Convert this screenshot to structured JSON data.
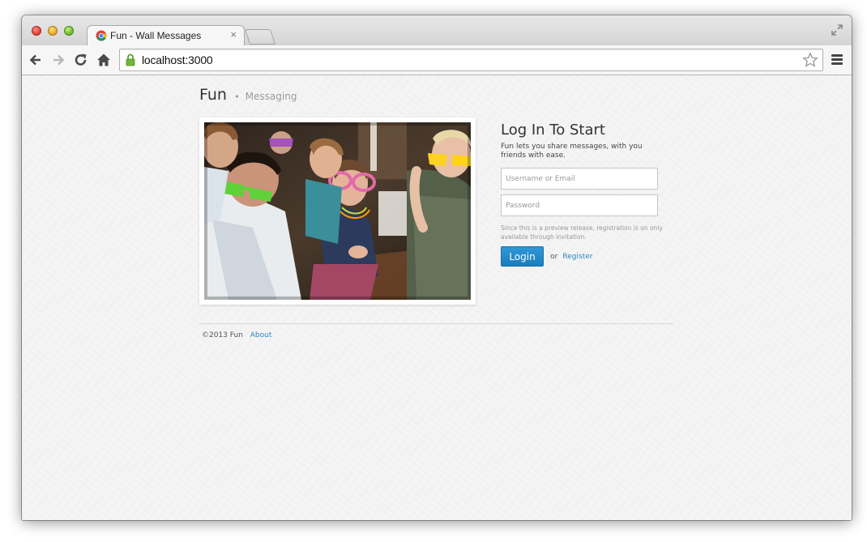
{
  "browser": {
    "tab": {
      "title": "Fun - Wall Messages",
      "close_glyph": "×",
      "favicon": "chrome-icon"
    },
    "address_bar": {
      "url": "localhost:3000"
    },
    "icons": {
      "back": "back-arrow-icon",
      "forward": "forward-arrow-icon",
      "reload": "reload-icon",
      "home": "home-icon",
      "secure": "lock-icon",
      "bookmark": "star-icon",
      "menu": "hamburger-menu-icon",
      "fullscreen": "fullscreen-icon"
    }
  },
  "site": {
    "brand": "Fun",
    "separator": "•",
    "subtitle": "Messaging"
  },
  "hero_image": {
    "description": "photo",
    "alt": ""
  },
  "login": {
    "title": "Log In To Start",
    "description": "Fun lets you share messages, with you friends with ease.",
    "username_placeholder": "Username or Email",
    "password_placeholder": "Password",
    "notice": "Since this is a preview release, registration is on only available through invitation.",
    "login_button": "Login",
    "or_text": "or",
    "register_link": "Register"
  },
  "footer": {
    "copyright": "©2013 Fun",
    "about_link": "About"
  },
  "colors": {
    "accent": "#2a85c2",
    "button": "#1c7cbf",
    "page_background": "#f3f3f3"
  }
}
